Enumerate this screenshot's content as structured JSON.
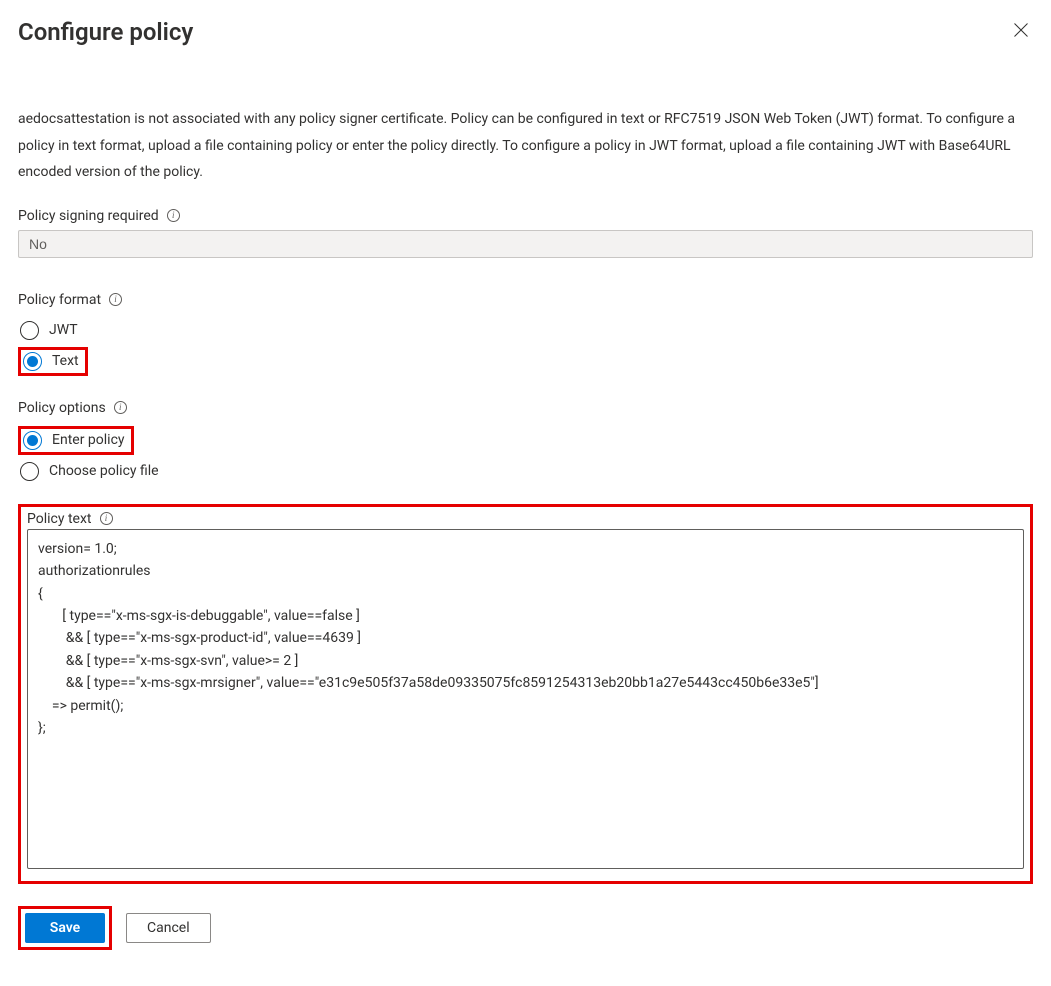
{
  "header": {
    "title": "Configure policy"
  },
  "description": "aedocsattestation is not associated with any policy signer certificate. Policy can be configured in text or RFC7519 JSON Web Token (JWT) format. To configure a policy in text format, upload a file containing policy or enter the policy directly. To configure a policy in JWT format, upload a file containing JWT with Base64URL encoded version of the policy.",
  "signing": {
    "label": "Policy signing required",
    "value": "No"
  },
  "format": {
    "label": "Policy format",
    "options": [
      {
        "label": "JWT",
        "checked": false,
        "highlight": false
      },
      {
        "label": "Text",
        "checked": true,
        "highlight": true
      }
    ]
  },
  "options": {
    "label": "Policy options",
    "options": [
      {
        "label": "Enter policy",
        "checked": true,
        "highlight": true
      },
      {
        "label": "Choose policy file",
        "checked": false,
        "highlight": false
      }
    ]
  },
  "policyText": {
    "label": "Policy text",
    "value": "version= 1.0;\nauthorizationrules\n{\n       [ type==\"x-ms-sgx-is-debuggable\", value==false ]\n        && [ type==\"x-ms-sgx-product-id\", value==4639 ]\n        && [ type==\"x-ms-sgx-svn\", value>= 2 ]\n        && [ type==\"x-ms-sgx-mrsigner\", value==\"e31c9e505f37a58de09335075fc8591254313eb20bb1a27e5443cc450b6e33e5\"]\n    => permit();\n};"
  },
  "footer": {
    "save": "Save",
    "cancel": "Cancel"
  }
}
